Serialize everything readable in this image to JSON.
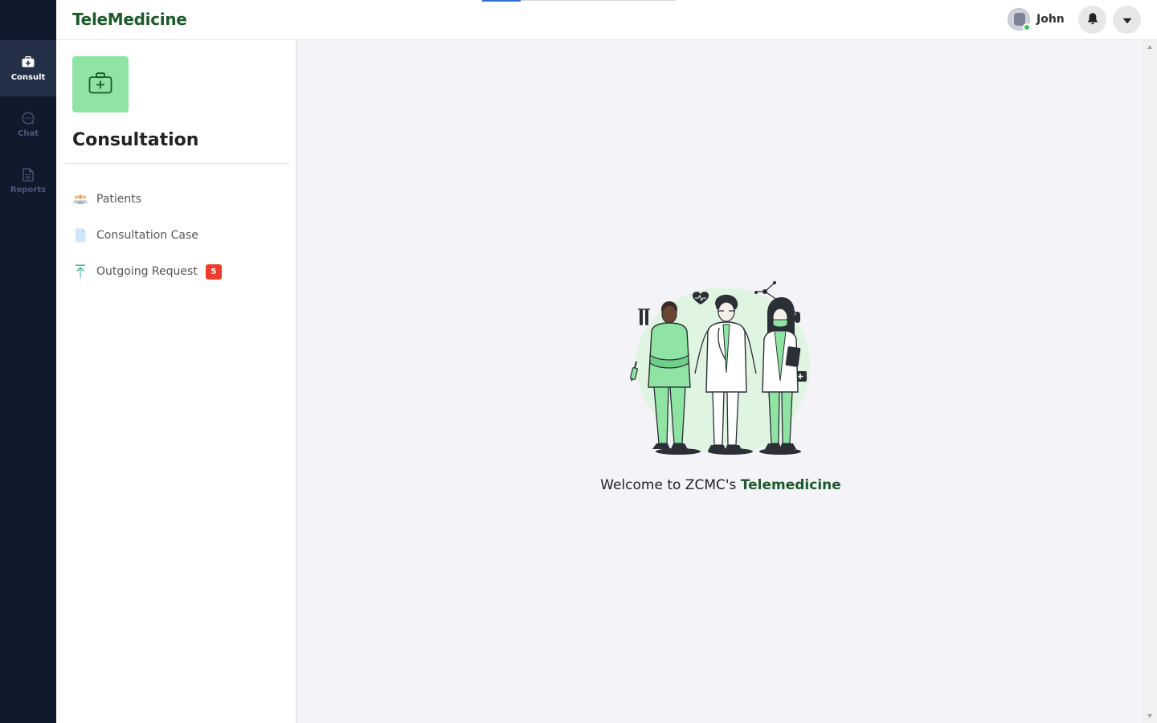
{
  "app": {
    "brand": "TeleMedicine"
  },
  "rail": {
    "items": [
      {
        "label": "Consult",
        "icon": "medkit-icon",
        "active": true
      },
      {
        "label": "Chat",
        "icon": "chat-bubble-icon",
        "active": false
      },
      {
        "label": "Reports",
        "icon": "document-icon",
        "active": false
      }
    ]
  },
  "header": {
    "user_name": "John",
    "icons": [
      "bell-icon",
      "chevron-down-icon"
    ]
  },
  "panel": {
    "title": "Consultation",
    "icon": "medkit-icon",
    "items": [
      {
        "label": "Patients",
        "icon": "users-icon"
      },
      {
        "label": "Consultation Case",
        "icon": "file-icon"
      },
      {
        "label": "Outgoing Request",
        "icon": "upload-arrow-icon",
        "badge": "5"
      }
    ]
  },
  "main": {
    "welcome_prefix": "Welcome to ZCMC's ",
    "welcome_brand": "Telemedicine"
  },
  "colors": {
    "rail_bg": "#111a2d",
    "rail_active": "#243048",
    "brand_green": "#1d5a2b",
    "accent_green": "#8fe3a3",
    "badge_red": "#ee3b2b",
    "content_bg": "#f4f3f8"
  }
}
